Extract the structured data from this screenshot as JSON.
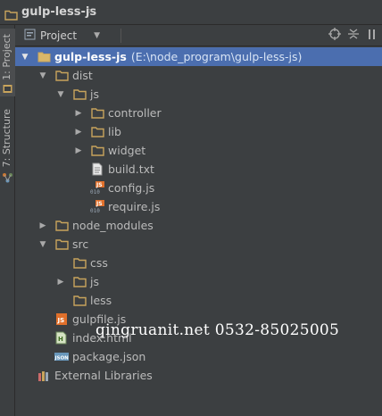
{
  "breadcrumb": {
    "title": "gulp-less-js"
  },
  "side_tabs": [
    {
      "label": "1: Project",
      "active": true
    },
    {
      "label": "7: Structure",
      "active": false
    }
  ],
  "panel": {
    "view_selector": "Project"
  },
  "tree": [
    {
      "depth": 0,
      "arrow": "down",
      "icon": "project-folder-icon",
      "label": "gulp-less-js",
      "path": "(E:\\node_program\\gulp-less-js)",
      "selected": true
    },
    {
      "depth": 1,
      "arrow": "down",
      "icon": "folder-icon",
      "label": "dist"
    },
    {
      "depth": 2,
      "arrow": "down",
      "icon": "folder-icon",
      "label": "js"
    },
    {
      "depth": 3,
      "arrow": "right",
      "icon": "folder-icon",
      "label": "controller"
    },
    {
      "depth": 3,
      "arrow": "right",
      "icon": "folder-icon",
      "label": "lib"
    },
    {
      "depth": 3,
      "arrow": "right",
      "icon": "folder-icon",
      "label": "widget"
    },
    {
      "depth": 3,
      "arrow": "none",
      "icon": "text-file-icon",
      "label": "build.txt"
    },
    {
      "depth": 3,
      "arrow": "none",
      "icon": "js-file-icon",
      "label": "config.js"
    },
    {
      "depth": 3,
      "arrow": "none",
      "icon": "js-file-icon",
      "label": "require.js"
    },
    {
      "depth": 1,
      "arrow": "right",
      "icon": "folder-icon",
      "label": "node_modules"
    },
    {
      "depth": 1,
      "arrow": "down",
      "icon": "folder-icon",
      "label": "src"
    },
    {
      "depth": 2,
      "arrow": "none",
      "icon": "folder-icon",
      "label": "css"
    },
    {
      "depth": 2,
      "arrow": "right",
      "icon": "folder-icon",
      "label": "js"
    },
    {
      "depth": 2,
      "arrow": "none",
      "icon": "folder-icon",
      "label": "less"
    },
    {
      "depth": 1,
      "arrow": "none",
      "icon": "js-file-orange-icon",
      "label": "gulpfile.js"
    },
    {
      "depth": 1,
      "arrow": "none",
      "icon": "html-file-icon",
      "label": "index.html"
    },
    {
      "depth": 1,
      "arrow": "none",
      "icon": "json-file-icon",
      "label": "package.json"
    },
    {
      "depth": 0,
      "arrow": "none",
      "icon": "libraries-icon",
      "label": "External Libraries"
    }
  ],
  "watermark": "qingruanit.net 0532-85025005",
  "colors": {
    "background": "#3c3f41",
    "selection": "#4b6eaf",
    "folder": "#c8a45c",
    "js_badge": "#e0702b"
  }
}
